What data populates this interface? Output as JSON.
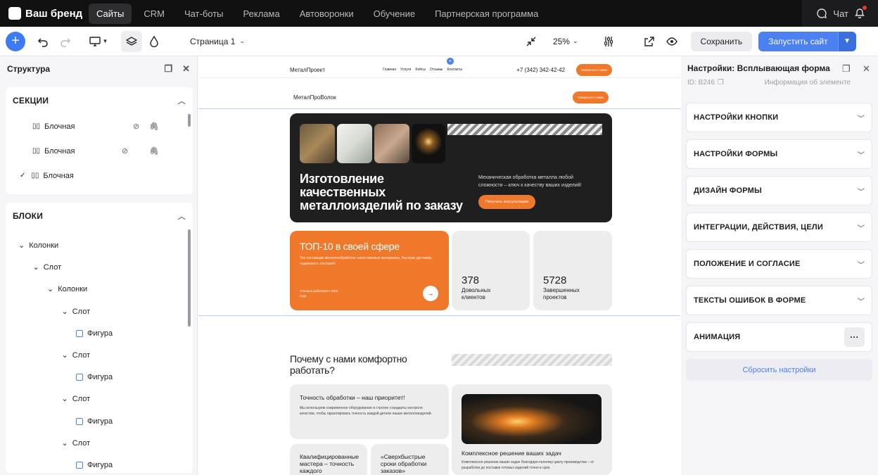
{
  "app": {
    "brand": "Ваш бренд",
    "nav": [
      "Сайты",
      "CRM",
      "Чат-боты",
      "Реклама",
      "Автоворонки",
      "Обучение",
      "Партнерская программа"
    ],
    "chat": "Чат"
  },
  "toolbar": {
    "page": "Страница 1",
    "zoom": "25%",
    "save": "Сохранить",
    "launch": "Запустить сайт"
  },
  "structure": {
    "title": "Структура",
    "sections_title": "СЕКЦИИ",
    "sections": [
      "Блочная",
      "Блочная",
      "Блочная"
    ],
    "blocks_title": "БЛОКИ",
    "tree": [
      {
        "label": "Колонки",
        "depth": 0
      },
      {
        "label": "Слот",
        "depth": 1
      },
      {
        "label": "Колонки",
        "depth": 2
      },
      {
        "label": "Слот",
        "depth": 3
      },
      {
        "label": "Фигура",
        "depth": 4
      },
      {
        "label": "Слот",
        "depth": 3
      },
      {
        "label": "Фигура",
        "depth": 4
      },
      {
        "label": "Слот",
        "depth": 3
      },
      {
        "label": "Фигура",
        "depth": 4
      },
      {
        "label": "Слот",
        "depth": 3
      },
      {
        "label": "Фигура",
        "depth": 4
      }
    ]
  },
  "site": {
    "header_logo": "МеталПроект",
    "header_menu": [
      "Главная",
      "Услуги",
      "Кейсы",
      "Отзывы",
      "Контакты"
    ],
    "phone": "+7 (342) 342-42-42",
    "header_btn": "Связаться с нами",
    "logo2": "МеталПроВолок",
    "header2_btn": "Связаться с нами",
    "hero_title": "Изготовление качественных металлоизделий по заказу",
    "hero_text": "Механическая обработка металла любой сложности – ключ к качеству ваших изделий!",
    "hero_btn": "Получить консультацию",
    "top_title": "ТОП-10 в своей сфере",
    "top_text": "Топ поставщик металлообработки: качественные материалы, быстрая доставка, надежность поставок!",
    "top_note": "Успешно работаем с 2015 года",
    "stat1_num": "378",
    "stat1_label": "Довольных клиентов",
    "stat2_num": "5728",
    "stat2_label": "Завершенных проектов",
    "why_title": "Почему с нами комфортно работать?",
    "c1_title": "Точность обработки – наш приоритет!",
    "c1_text": "Мы используем современное оборудование и строгие стандарты контроля качества, чтобы гарантировать точность каждой детали наших металлоизделий.",
    "c2_title": "Комплексное решение ваших задач",
    "c2_text": "Комплексное решение ваших задач благодаря полному циклу производства – от разработки до поставки готовых изделий точно в срок.",
    "c3_title": "Квалифицированные мастера – точность каждого",
    "c4_title": "«Сверхбыстрые сроки обработки заказов»"
  },
  "settings": {
    "title": "Настройки: Всплывающая форма",
    "id": "ID: B246",
    "info": "Информация об элементе",
    "sections": [
      "НАСТРОЙКИ КНОПКИ",
      "НАСТРОЙКИ ФОРМЫ",
      "ДИЗАЙН ФОРМЫ",
      "ИНТЕГРАЦИИ, ДЕЙСТВИЯ, ЦЕЛИ",
      "ПОЛОЖЕНИЕ И СОГЛАСИЕ",
      "ТЕКСТЫ ОШИБОК В ФОРМЕ",
      "АНИМАЦИЯ"
    ],
    "reset": "Сбросить настройки"
  },
  "colors": {
    "accent": "#4a80f0",
    "orange": "#f0782a",
    "dark": "#1f1f1f"
  }
}
